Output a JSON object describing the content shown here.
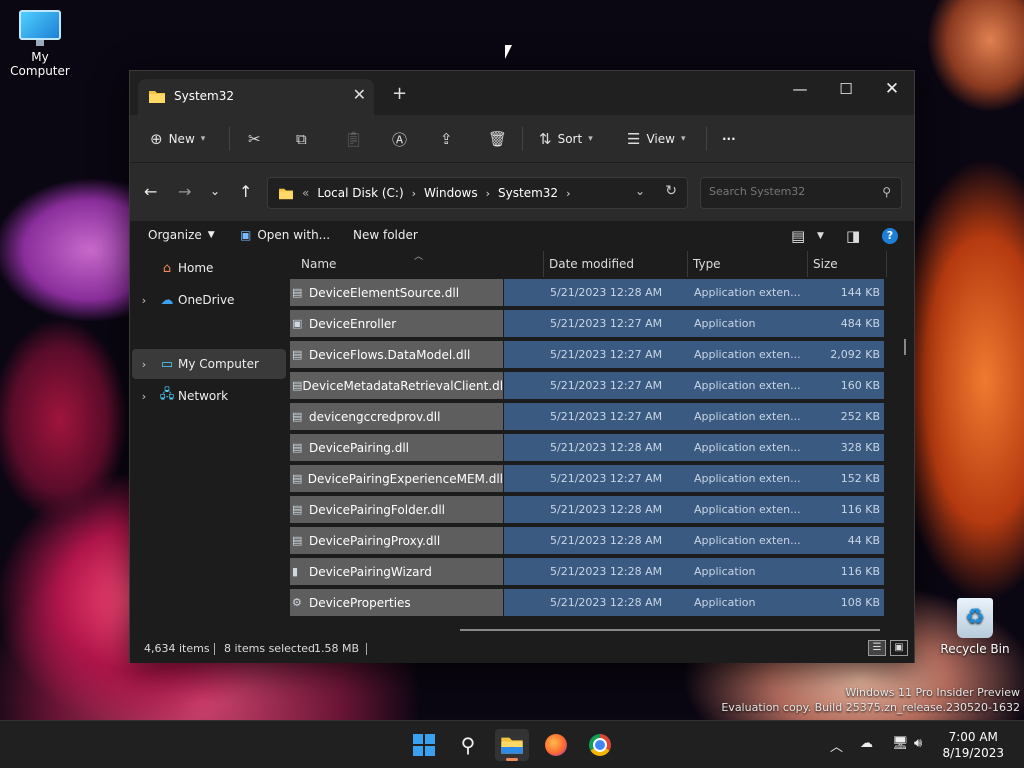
{
  "desktop": {
    "icons": [
      {
        "label": "My Computer"
      },
      {
        "label": "Recycle Bin"
      }
    ],
    "watermark": {
      "line1": "Windows 11 Pro Insider Preview",
      "line2": "Evaluation copy. Build 25375.zn_release.230520-1632"
    }
  },
  "window": {
    "tab_title": "System32",
    "controls": {
      "minimize": "—",
      "maximize": "☐",
      "close": "✕"
    },
    "toolbar": {
      "new_label": "New",
      "sort_label": "Sort",
      "view_label": "View",
      "more_label": "···"
    },
    "address": {
      "overflow": "«",
      "crumbs": [
        "Local Disk (C:)",
        "Windows",
        "System32"
      ],
      "search_placeholder": "Search System32"
    },
    "commands": {
      "organize": "Organize",
      "open_with": "Open with...",
      "new_folder": "New folder"
    },
    "navpane": [
      {
        "label": "Home",
        "icon": "home-icon",
        "expandable": false
      },
      {
        "label": "OneDrive",
        "icon": "cloud-icon",
        "expandable": true
      },
      {
        "label": "My Computer",
        "icon": "computer-icon",
        "expandable": true,
        "selected": true
      },
      {
        "label": "Network",
        "icon": "network-icon",
        "expandable": true
      }
    ],
    "columns": {
      "name": "Name",
      "date": "Date modified",
      "type": "Type",
      "size": "Size"
    },
    "files": [
      {
        "name": "DeviceElementSource.dll",
        "date": "5/21/2023 12:28 AM",
        "type": "Application exten...",
        "size": "144 KB",
        "icon": "dll-file-icon"
      },
      {
        "name": "DeviceEnroller",
        "date": "5/21/2023 12:27 AM",
        "type": "Application",
        "size": "484 KB",
        "icon": "app-icon"
      },
      {
        "name": "DeviceFlows.DataModel.dll",
        "date": "5/21/2023 12:27 AM",
        "type": "Application exten...",
        "size": "2,092 KB",
        "icon": "dll-file-icon"
      },
      {
        "name": "DeviceMetadataRetrievalClient.dll",
        "date": "5/21/2023 12:27 AM",
        "type": "Application exten...",
        "size": "160 KB",
        "icon": "dll-file-icon"
      },
      {
        "name": "devicengccredprov.dll",
        "date": "5/21/2023 12:27 AM",
        "type": "Application exten...",
        "size": "252 KB",
        "icon": "dll-file-icon"
      },
      {
        "name": "DevicePairing.dll",
        "date": "5/21/2023 12:28 AM",
        "type": "Application exten...",
        "size": "328 KB",
        "icon": "dll-file-icon"
      },
      {
        "name": "DevicePairingExperienceMEM.dll",
        "date": "5/21/2023 12:27 AM",
        "type": "Application exten...",
        "size": "152 KB",
        "icon": "dll-file-icon"
      },
      {
        "name": "DevicePairingFolder.dll",
        "date": "5/21/2023 12:28 AM",
        "type": "Application exten...",
        "size": "116 KB",
        "icon": "dll-file-icon"
      },
      {
        "name": "DevicePairingProxy.dll",
        "date": "5/21/2023 12:28 AM",
        "type": "Application exten...",
        "size": "44 KB",
        "icon": "dll-file-icon"
      },
      {
        "name": "DevicePairingWizard",
        "date": "5/21/2023 12:28 AM",
        "type": "Application",
        "size": "116 KB",
        "icon": "wizard-app-icon"
      },
      {
        "name": "DeviceProperties",
        "date": "5/21/2023 12:28 AM",
        "type": "Application",
        "size": "108 KB",
        "icon": "properties-app-icon"
      }
    ],
    "status": {
      "item_count": "4,634 items",
      "selected": "8 items selected",
      "selected_size": "1.58 MB"
    }
  },
  "taskbar": {
    "clock_time": "7:00 AM",
    "clock_date": "8/19/2023"
  },
  "colors": {
    "selection_row": "#3a5a82",
    "name_cell": "#5e5e5e",
    "accent": "#3aa0f0"
  }
}
